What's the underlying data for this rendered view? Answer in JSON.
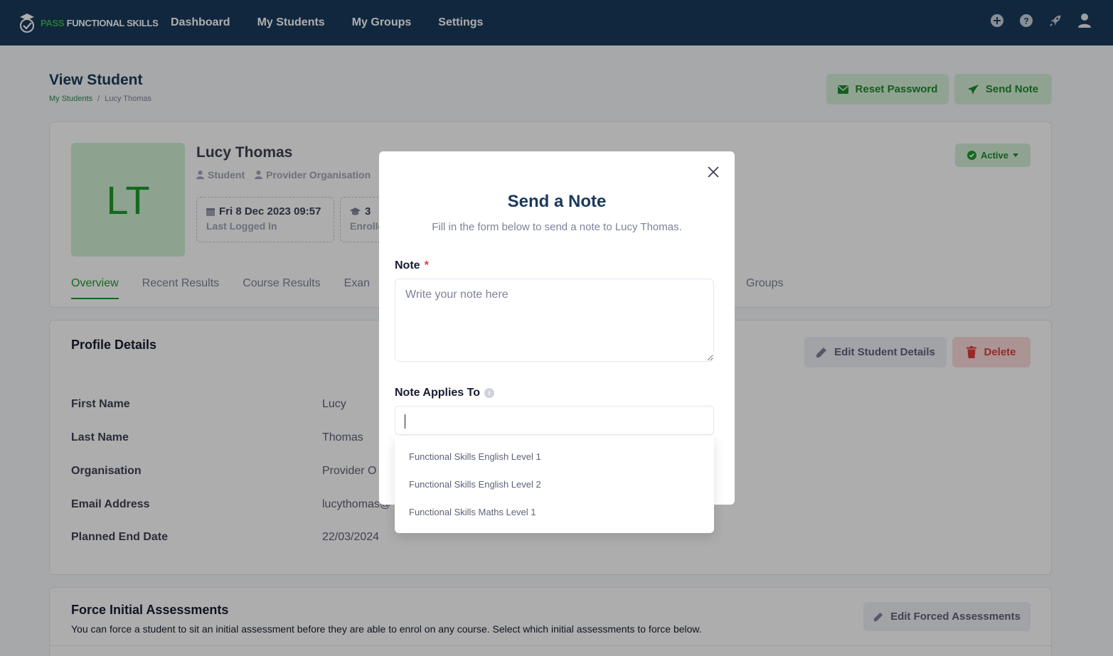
{
  "app": {
    "brand_pass": "PASS",
    "brand_rest": "FUNCTIONAL SKILLS"
  },
  "nav": {
    "items": [
      "Dashboard",
      "My Students",
      "My Groups",
      "Settings"
    ]
  },
  "page": {
    "title": "View Student",
    "breadcrumb": {
      "root": "My Students",
      "separator": "/",
      "current": "Lucy Thomas"
    },
    "reset_password_label": "Reset Password",
    "send_note_label": "Send Note"
  },
  "student": {
    "initials": "LT",
    "name": "Lucy Thomas",
    "role": "Student",
    "organisation_tag": "Provider Organisation",
    "status": "Active",
    "last_logged_in_value": "Fri 8 Dec 2023 09:57",
    "last_logged_in_label": "Last Logged In",
    "enrolled_value": "3",
    "enrolled_label": "Enrolle"
  },
  "tabs": [
    "Overview",
    "Recent Results",
    "Course Results",
    "Exan",
    "Groups"
  ],
  "profile": {
    "title": "Profile Details",
    "edit_label": "Edit Student Details",
    "delete_label": "Delete",
    "rows": [
      {
        "key": "First Name",
        "value": "Lucy"
      },
      {
        "key": "Last Name",
        "value": "Thomas"
      },
      {
        "key": "Organisation",
        "value": "Provider O"
      },
      {
        "key": "Email Address",
        "value": "lucythomas@"
      },
      {
        "key": "Planned End Date",
        "value": "22/03/2024"
      }
    ]
  },
  "force": {
    "title": "Force Initial Assessments",
    "desc": "You can force a student to sit an initial assessment before they are able to enrol on any course. Select which initial assessments to force below.",
    "edit_label": "Edit Forced Assessments"
  },
  "modal": {
    "title": "Send a Note",
    "subtitle": "Fill in the form below to send a note to Lucy Thomas.",
    "note_label": "Note",
    "required_mark": "*",
    "note_placeholder": "Write your note here",
    "applies_label": "Note Applies To",
    "applies_value": "",
    "options": [
      "Functional Skills English Level 1",
      "Functional Skills English Level 2",
      "Functional Skills Maths Level 1"
    ]
  },
  "colors": {
    "nav_bg": "#1a3a5c",
    "accent_green": "#1f9a2e",
    "danger": "#e23d3d"
  }
}
